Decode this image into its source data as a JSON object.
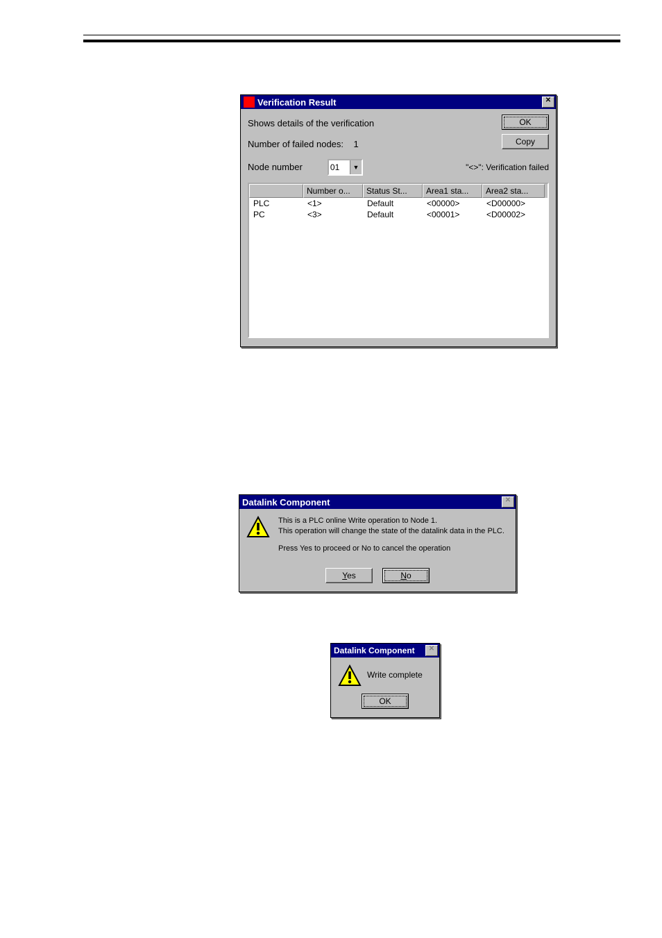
{
  "verification": {
    "title": "Verification Result",
    "close_glyph": "✕",
    "subtitle": "Shows details of the verification",
    "failed_label": "Number of failed nodes:",
    "failed_count": "1",
    "node_label": "Node number",
    "node_value": "01",
    "legend": "\"<>\": Verification failed",
    "ok_label": "OK",
    "copy_label": "Copy",
    "columns": [
      "",
      "Number o...",
      "Status St...",
      "Area1 sta...",
      "Area2 sta..."
    ],
    "rows": [
      {
        "c0": "PLC",
        "c1": "<1>",
        "c2": "Default",
        "c3": "<00000>",
        "c4": "<D00000>"
      },
      {
        "c0": "PC",
        "c1": "<3>",
        "c2": "Default",
        "c3": "<00001>",
        "c4": "<D00002>"
      }
    ]
  },
  "confirm": {
    "title": "Datalink Component",
    "close_glyph": "✕",
    "line1": "This is a PLC online Write operation to Node 1.",
    "line2": "This operation will change the state of the datalink data in the PLC.",
    "line3": "Press Yes to proceed or No to cancel the operation",
    "yes_label": "Yes",
    "no_label": "No"
  },
  "complete": {
    "title": "Datalink Component",
    "close_glyph": "✕",
    "message": "Write complete",
    "ok_label": "OK"
  }
}
